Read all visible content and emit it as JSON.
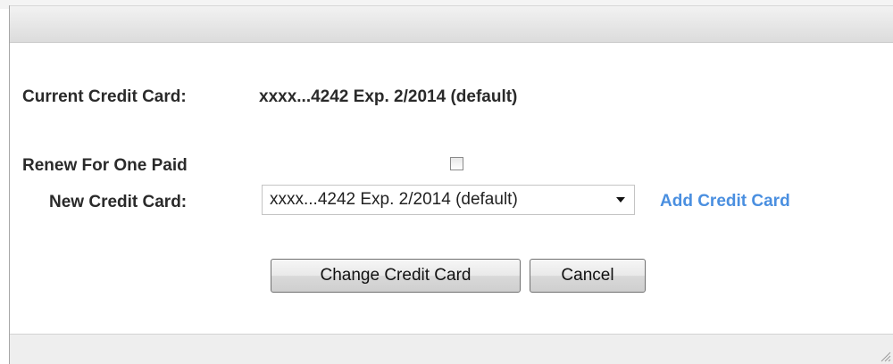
{
  "dialog": {
    "current_card_label": "Current Credit Card:",
    "current_card_value": "xxxx...4242 Exp. 2/2014 (default)",
    "renew_label": "Renew For One Paid",
    "renew_checked": false,
    "new_card_label": "New Credit Card:",
    "new_card_selected": "xxxx...4242 Exp. 2/2014 (default)",
    "add_card_link": "Add Credit Card",
    "change_button": "Change Credit Card",
    "cancel_button": "Cancel"
  },
  "colors": {
    "link": "#4a8fe0",
    "label_text": "#2a2a2a",
    "titlebar": "#e4e4e4"
  },
  "icons": {
    "select_arrow": "chevron-down-icon",
    "resize_grip": "resize-grip-icon"
  }
}
